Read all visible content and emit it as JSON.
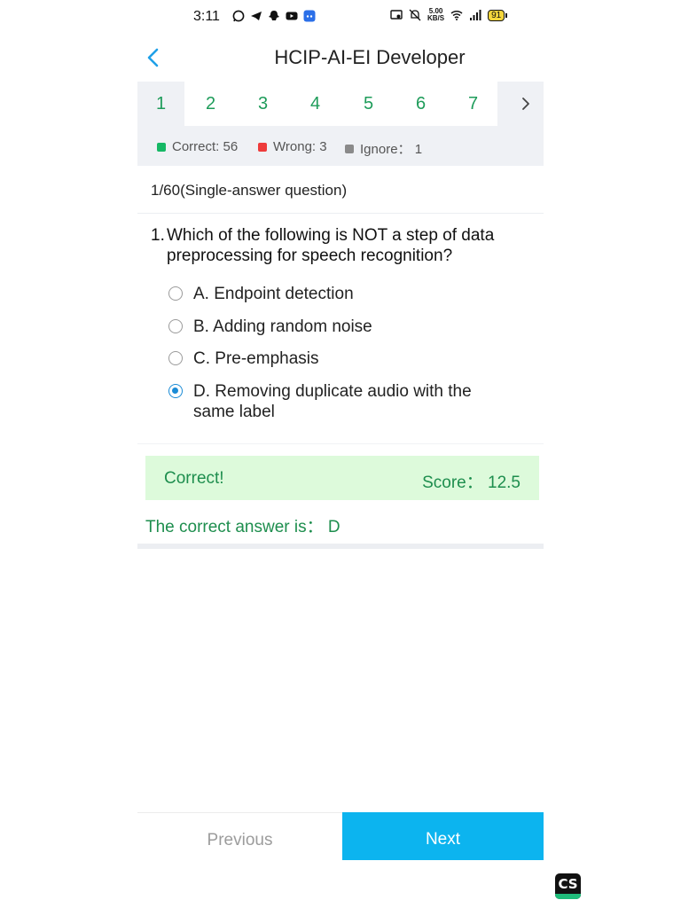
{
  "status_bar": {
    "time": "3:11",
    "speed_top": "5.00",
    "speed_bottom": "KB/S",
    "battery": "91",
    "left_icons": [
      "whatsapp-icon",
      "telegram-icon",
      "snapchat-icon",
      "youtube-icon",
      "discord-icon"
    ],
    "right_icons": [
      "screen-cast-icon",
      "mute-icon",
      "wifi-icon",
      "signal-icon",
      "battery-icon"
    ]
  },
  "header": {
    "title": "HCIP-AI-EI Developer",
    "back_icon": "chevron-left-icon"
  },
  "question_tabs": {
    "items": [
      "1",
      "2",
      "3",
      "4",
      "5",
      "6",
      "7"
    ],
    "active": "1",
    "next_icon": "chevron-right-icon"
  },
  "stats": {
    "correct": "Correct: 56",
    "wrong": "Wrong: 3",
    "ignore": "Ignore： 1",
    "colors": {
      "correct": "#16b865",
      "wrong": "#ee3b3b",
      "ignore": "#8a8a8a"
    }
  },
  "question": {
    "type": "1/60(Single-answer question)",
    "number": "1.",
    "text": "Which of the following is NOT a step of data preprocessing for speech recognition?",
    "options": [
      {
        "label": "A. Endpoint detection",
        "selected": false
      },
      {
        "label": "B. Adding random noise",
        "selected": false
      },
      {
        "label": "C. Pre-emphasis",
        "selected": false
      },
      {
        "label": "D. Removing duplicate audio with the same label",
        "selected": true
      }
    ]
  },
  "result": {
    "status": "Correct!",
    "score": "Score： 12.5",
    "answer_text": "The correct answer is： D"
  },
  "nav": {
    "previous_label": "Previous",
    "next_label": "Next"
  },
  "watermark": {
    "text": "CS"
  },
  "colors": {
    "accent_green": "#1e8e4e",
    "tab_green": "#1e9c5a",
    "next_blue": "#0cb4ef",
    "radio_blue": "#1a8bd6",
    "result_bg": "#ddfadb"
  }
}
